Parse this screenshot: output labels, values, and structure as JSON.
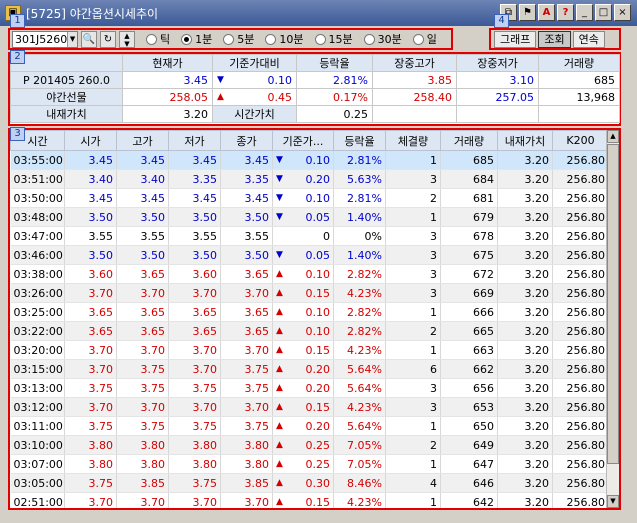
{
  "window": {
    "title": "[5725] 야간옵션시세추이",
    "icon_label": "▣",
    "buttons": [
      "⧉",
      "⚑",
      "A",
      "?",
      "_",
      "□",
      "×"
    ]
  },
  "badges": [
    "1",
    "2",
    "3",
    "4"
  ],
  "toolbar": {
    "code": "301J5260",
    "search_icon": "magnifier-icon",
    "reset_icon": "refresh-icon",
    "spin": "▲▼",
    "radios": [
      {
        "label": "틱",
        "checked": false
      },
      {
        "label": "1분",
        "checked": true
      },
      {
        "label": "5분",
        "checked": false
      },
      {
        "label": "10분",
        "checked": false
      },
      {
        "label": "15분",
        "checked": false
      },
      {
        "label": "30분",
        "checked": false
      },
      {
        "label": "일",
        "checked": false
      }
    ],
    "graph_label": "그래프",
    "query_label": "조회",
    "continuous_label": "연속"
  },
  "summary": {
    "headers": [
      "현재가",
      "기준가대비",
      "등락율",
      "장중고가",
      "장중저가",
      "거래량"
    ],
    "row1": {
      "label": "P 201405 260.0",
      "current": "3.45",
      "change": "0.10",
      "rate": "2.81%",
      "high": "3.85",
      "low": "3.10",
      "volume": "685"
    },
    "row2": {
      "label": "야간선물",
      "current": "258.05",
      "change": "0.45",
      "rate": "0.17%",
      "high": "258.40",
      "low": "257.05",
      "volume": "13,968"
    },
    "row3": {
      "label1": "내재가치",
      "value1": "3.20",
      "label2": "시간가치",
      "value2": "0.25"
    }
  },
  "grid": {
    "headers": [
      "시간",
      "시가",
      "고가",
      "저가",
      "종가",
      "기준가...",
      "등락율",
      "체결량",
      "거래량",
      "내재가치",
      "K200"
    ],
    "rows": [
      {
        "t": "03:55:00",
        "o": "3.45",
        "h": "3.45",
        "l": "3.45",
        "c": "3.45",
        "dir": "down",
        "chg": "0.10",
        "rate": "2.81%",
        "qty": "1",
        "vol": "685",
        "intr": "3.20",
        "k": "256.80"
      },
      {
        "t": "03:51:00",
        "o": "3.40",
        "h": "3.40",
        "l": "3.35",
        "c": "3.35",
        "dir": "down",
        "chg": "0.20",
        "rate": "5.63%",
        "qty": "3",
        "vol": "684",
        "intr": "3.20",
        "k": "256.80"
      },
      {
        "t": "03:50:00",
        "o": "3.45",
        "h": "3.45",
        "l": "3.45",
        "c": "3.45",
        "dir": "down",
        "chg": "0.10",
        "rate": "2.81%",
        "qty": "2",
        "vol": "681",
        "intr": "3.20",
        "k": "256.80"
      },
      {
        "t": "03:48:00",
        "o": "3.50",
        "h": "3.50",
        "l": "3.50",
        "c": "3.50",
        "dir": "down",
        "chg": "0.05",
        "rate": "1.40%",
        "qty": "1",
        "vol": "679",
        "intr": "3.20",
        "k": "256.80"
      },
      {
        "t": "03:47:00",
        "o": "3.55",
        "h": "3.55",
        "l": "3.55",
        "c": "3.55",
        "dir": "none",
        "chg": "0",
        "rate": "0%",
        "qty": "3",
        "vol": "678",
        "intr": "3.20",
        "k": "256.80"
      },
      {
        "t": "03:46:00",
        "o": "3.50",
        "h": "3.50",
        "l": "3.50",
        "c": "3.50",
        "dir": "down",
        "chg": "0.05",
        "rate": "1.40%",
        "qty": "3",
        "vol": "675",
        "intr": "3.20",
        "k": "256.80"
      },
      {
        "t": "03:38:00",
        "o": "3.60",
        "h": "3.65",
        "l": "3.60",
        "c": "3.65",
        "dir": "up",
        "chg": "0.10",
        "rate": "2.82%",
        "qty": "3",
        "vol": "672",
        "intr": "3.20",
        "k": "256.80"
      },
      {
        "t": "03:26:00",
        "o": "3.70",
        "h": "3.70",
        "l": "3.70",
        "c": "3.70",
        "dir": "up",
        "chg": "0.15",
        "rate": "4.23%",
        "qty": "3",
        "vol": "669",
        "intr": "3.20",
        "k": "256.80"
      },
      {
        "t": "03:25:00",
        "o": "3.65",
        "h": "3.65",
        "l": "3.65",
        "c": "3.65",
        "dir": "up",
        "chg": "0.10",
        "rate": "2.82%",
        "qty": "1",
        "vol": "666",
        "intr": "3.20",
        "k": "256.80"
      },
      {
        "t": "03:22:00",
        "o": "3.65",
        "h": "3.65",
        "l": "3.65",
        "c": "3.65",
        "dir": "up",
        "chg": "0.10",
        "rate": "2.82%",
        "qty": "2",
        "vol": "665",
        "intr": "3.20",
        "k": "256.80"
      },
      {
        "t": "03:20:00",
        "o": "3.70",
        "h": "3.70",
        "l": "3.70",
        "c": "3.70",
        "dir": "up",
        "chg": "0.15",
        "rate": "4.23%",
        "qty": "1",
        "vol": "663",
        "intr": "3.20",
        "k": "256.80"
      },
      {
        "t": "03:15:00",
        "o": "3.70",
        "h": "3.75",
        "l": "3.70",
        "c": "3.75",
        "dir": "up",
        "chg": "0.20",
        "rate": "5.64%",
        "qty": "6",
        "vol": "662",
        "intr": "3.20",
        "k": "256.80"
      },
      {
        "t": "03:13:00",
        "o": "3.75",
        "h": "3.75",
        "l": "3.75",
        "c": "3.75",
        "dir": "up",
        "chg": "0.20",
        "rate": "5.64%",
        "qty": "3",
        "vol": "656",
        "intr": "3.20",
        "k": "256.80"
      },
      {
        "t": "03:12:00",
        "o": "3.70",
        "h": "3.70",
        "l": "3.70",
        "c": "3.70",
        "dir": "up",
        "chg": "0.15",
        "rate": "4.23%",
        "qty": "3",
        "vol": "653",
        "intr": "3.20",
        "k": "256.80"
      },
      {
        "t": "03:11:00",
        "o": "3.75",
        "h": "3.75",
        "l": "3.75",
        "c": "3.75",
        "dir": "up",
        "chg": "0.20",
        "rate": "5.64%",
        "qty": "1",
        "vol": "650",
        "intr": "3.20",
        "k": "256.80"
      },
      {
        "t": "03:10:00",
        "o": "3.80",
        "h": "3.80",
        "l": "3.80",
        "c": "3.80",
        "dir": "up",
        "chg": "0.25",
        "rate": "7.05%",
        "qty": "2",
        "vol": "649",
        "intr": "3.20",
        "k": "256.80"
      },
      {
        "t": "03:07:00",
        "o": "3.80",
        "h": "3.80",
        "l": "3.80",
        "c": "3.80",
        "dir": "up",
        "chg": "0.25",
        "rate": "7.05%",
        "qty": "1",
        "vol": "647",
        "intr": "3.20",
        "k": "256.80"
      },
      {
        "t": "03:05:00",
        "o": "3.75",
        "h": "3.85",
        "l": "3.75",
        "c": "3.85",
        "dir": "up",
        "chg": "0.30",
        "rate": "8.46%",
        "qty": "4",
        "vol": "646",
        "intr": "3.20",
        "k": "256.80"
      },
      {
        "t": "02:51:00",
        "o": "3.70",
        "h": "3.70",
        "l": "3.70",
        "c": "3.70",
        "dir": "up",
        "chg": "0.15",
        "rate": "4.23%",
        "qty": "1",
        "vol": "642",
        "intr": "3.20",
        "k": "256.80"
      }
    ]
  },
  "colors": {
    "up": "#d40000",
    "down": "#0000cc",
    "highlight": "#e00000",
    "header": "#dde6f3",
    "selected_row": "#cfe6fb"
  }
}
